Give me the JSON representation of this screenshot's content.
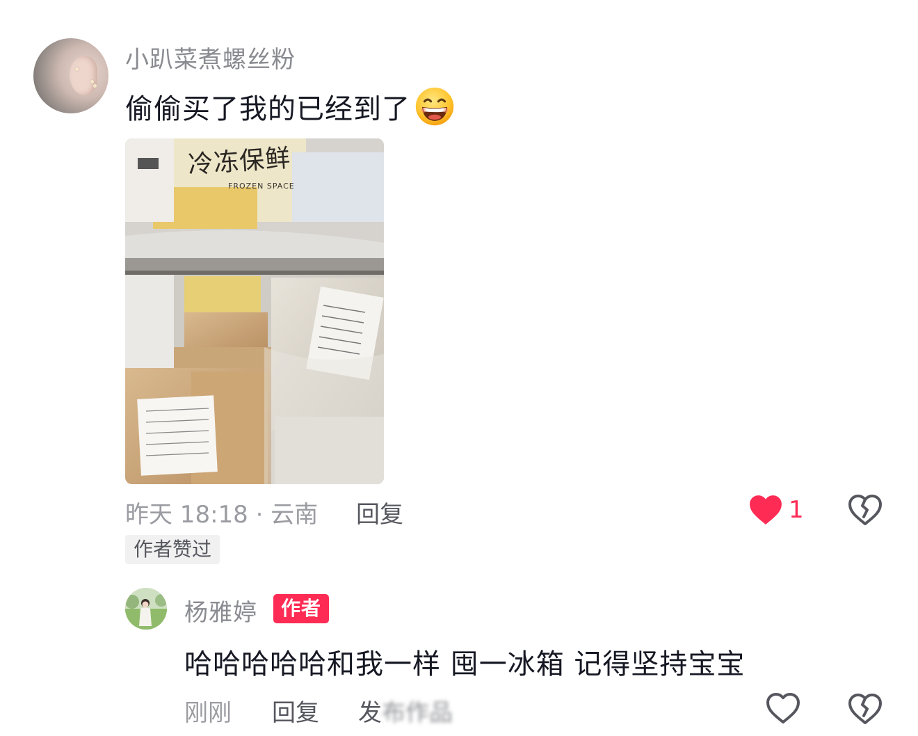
{
  "main_comment": {
    "username": "小趴菜煮螺丝粉",
    "text": "偷偷买了我的已经到了",
    "emoji": "grinning-face",
    "photo_label": "冷冻保鲜",
    "photo_sublabel": "FROZEN SPACE",
    "meta": "昨天 18:18 · 云南",
    "reply_label": "回复",
    "like_count": "1",
    "liked": true,
    "author_liked_badge": "作者赞过"
  },
  "reply": {
    "username": "杨雅婷",
    "author_tag": "作者",
    "text": "哈哈哈哈哈和我一样 囤一冰箱 记得坚持宝宝",
    "time": "刚刚",
    "reply_label": "回复",
    "extra_label": "发",
    "extra_blurred": "布作品",
    "liked": false
  },
  "colors": {
    "accent": "#fe2c55",
    "secondary_text": "#8a8b91",
    "primary_text": "#161823"
  }
}
